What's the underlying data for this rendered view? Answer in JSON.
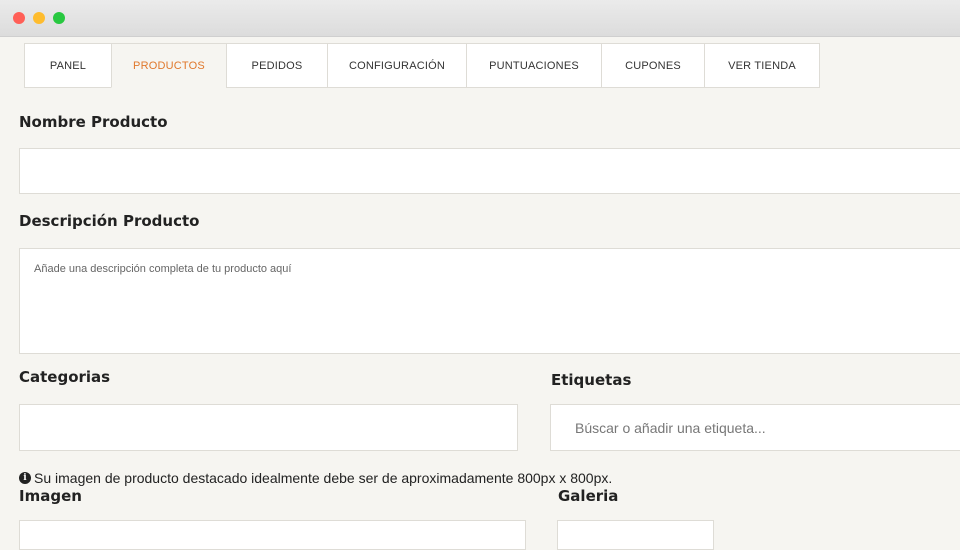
{
  "window": {
    "controls": [
      "close",
      "minimize",
      "maximize"
    ]
  },
  "tabs": [
    {
      "label": "PANEL",
      "active": false
    },
    {
      "label": "PRODUCTOS",
      "active": true
    },
    {
      "label": "PEDIDOS",
      "active": false
    },
    {
      "label": "CONFIGURACIÓN",
      "active": false
    },
    {
      "label": "PUNTUACIONES",
      "active": false
    },
    {
      "label": "CUPONES",
      "active": false
    },
    {
      "label": "VER TIENDA",
      "active": false
    }
  ],
  "form": {
    "name_label": "Nombre Producto",
    "name_value": "",
    "description_label": "Descripción Producto",
    "description_placeholder": "Añade una descripción completa de tu producto aquí",
    "categories_label": "Categorias",
    "tags_label": "Etiquetas",
    "tags_placeholder": "Búscar o añadir una etiqueta...",
    "image_note": "Su imagen de producto destacado idealmente debe ser de aproximadamente 800px x 800px.",
    "image_label": "Imagen",
    "gallery_label": "Galeria"
  },
  "colors": {
    "accent": "#e0782c",
    "background": "#f6f5f1",
    "border": "#dedcd6"
  },
  "icons": {
    "note": "info-icon"
  }
}
